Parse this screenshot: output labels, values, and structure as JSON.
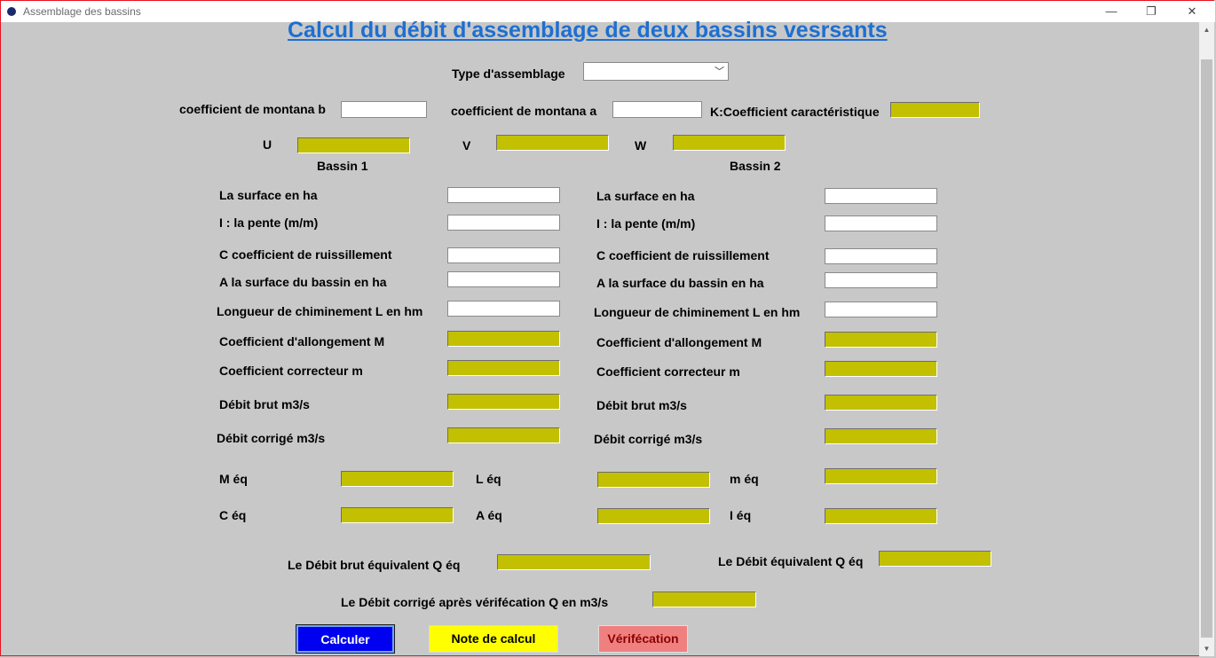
{
  "window": {
    "title": "Assemblage des bassins",
    "minimize": "—",
    "restore": "❐",
    "close": "✕"
  },
  "main_title": "Calcul du débit d'assemblage de deux  bassins vesrsants ",
  "assembly": {
    "label": "Type d'assemblage",
    "value": ""
  },
  "montana": {
    "b_label": "coefficient de montana b",
    "a_label": "coefficient de montana a",
    "k_label": "K:Coefficient caractéristique"
  },
  "uvw": {
    "u": "U",
    "v": "V",
    "w": "W"
  },
  "bassin1": {
    "title": "Bassin 1",
    "surface": "La surface en ha",
    "pente": "I : la pente (m/m)",
    "ruissellement": "C coefficient de ruissillement",
    "surface_bassin": "A la surface du bassin en ha",
    "longueur": "Longueur de chiminement L en hm",
    "allongement": "Coefficient d'allongement  M",
    "correcteur": "Coefficient correcteur  m",
    "debit_brut": "Débit brut m3/s",
    "debit_corrige": "Débit corrigé m3/s"
  },
  "bassin2": {
    "title": "Bassin 2",
    "surface": "La surface en ha",
    "pente": "I : la pente (m/m)",
    "ruissellement": "C coefficient de ruissillement",
    "surface_bassin": "A la surface du bassin en ha",
    "longueur": "Longueur de chiminement L en hm",
    "allongement": "Coefficient d'allongement  M",
    "correcteur": "Coefficient correcteur  m",
    "debit_brut": "Débit brut m3/s",
    "debit_corrige": "Débit corrigé m3/s"
  },
  "equivalents": {
    "m_eq": "M éq",
    "l_eq": "L éq",
    "small_m_eq": "m éq",
    "c_eq": "C éq",
    "a_eq": "A éq",
    "i_eq": "I éq"
  },
  "results": {
    "debit_brut_eq": "Le Débit  brut équivalent Q éq",
    "debit_eq": "Le Débit équivalent Q éq",
    "debit_corrige": "Le Débit  corrigé après vérifécation  Q  en m3/s"
  },
  "buttons": {
    "calculer": "Calculer",
    "note": "Note de calcul",
    "verif": "Vérifécation"
  },
  "colors": {
    "output_field": "#c2c000",
    "calculer_bg": "#0000f0",
    "note_bg": "#ffff00",
    "verif_bg": "#f08080",
    "title": "#1e6fd0"
  }
}
